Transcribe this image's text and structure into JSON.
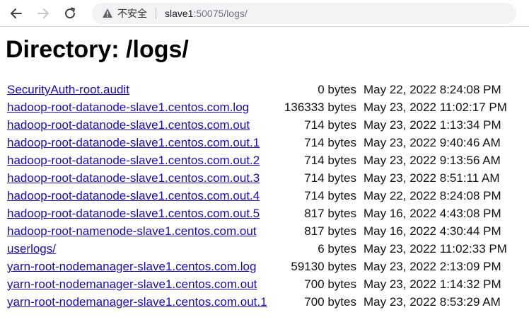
{
  "toolbar": {
    "security_label": "不安全",
    "url_host": "slave1",
    "url_rest": ":50075/logs/"
  },
  "page": {
    "title": "Directory: /logs/"
  },
  "files": [
    {
      "name": "SecurityAuth-root.audit",
      "size": "0 bytes",
      "date": "May 22, 2022 8:24:08 PM"
    },
    {
      "name": "hadoop-root-datanode-slave1.centos.com.log",
      "size": "136333 bytes",
      "date": "May 23, 2022 11:02:17 PM"
    },
    {
      "name": "hadoop-root-datanode-slave1.centos.com.out",
      "size": "714 bytes",
      "date": "May 23, 2022 1:13:34 PM"
    },
    {
      "name": "hadoop-root-datanode-slave1.centos.com.out.1",
      "size": "714 bytes",
      "date": "May 23, 2022 9:40:46 AM"
    },
    {
      "name": "hadoop-root-datanode-slave1.centos.com.out.2",
      "size": "714 bytes",
      "date": "May 23, 2022 9:13:56 AM"
    },
    {
      "name": "hadoop-root-datanode-slave1.centos.com.out.3",
      "size": "714 bytes",
      "date": "May 23, 2022 8:51:11 AM"
    },
    {
      "name": "hadoop-root-datanode-slave1.centos.com.out.4",
      "size": "714 bytes",
      "date": "May 22, 2022 8:24:08 PM"
    },
    {
      "name": "hadoop-root-datanode-slave1.centos.com.out.5",
      "size": "817 bytes",
      "date": "May 16, 2022 4:43:08 PM"
    },
    {
      "name": "hadoop-root-namenode-slave1.centos.com.out",
      "size": "817 bytes",
      "date": "May 16, 2022 4:30:44 PM"
    },
    {
      "name": "userlogs/",
      "size": "6 bytes",
      "date": "May 23, 2022 11:02:33 PM"
    },
    {
      "name": "yarn-root-nodemanager-slave1.centos.com.log",
      "size": "59130 bytes",
      "date": "May 23, 2022 2:13:09 PM"
    },
    {
      "name": "yarn-root-nodemanager-slave1.centos.com.out",
      "size": "700 bytes",
      "date": "May 23, 2022 1:14:32 PM"
    },
    {
      "name": "yarn-root-nodemanager-slave1.centos.com.out.1",
      "size": "700 bytes",
      "date": "May 23, 2022 8:53:29 AM"
    }
  ]
}
